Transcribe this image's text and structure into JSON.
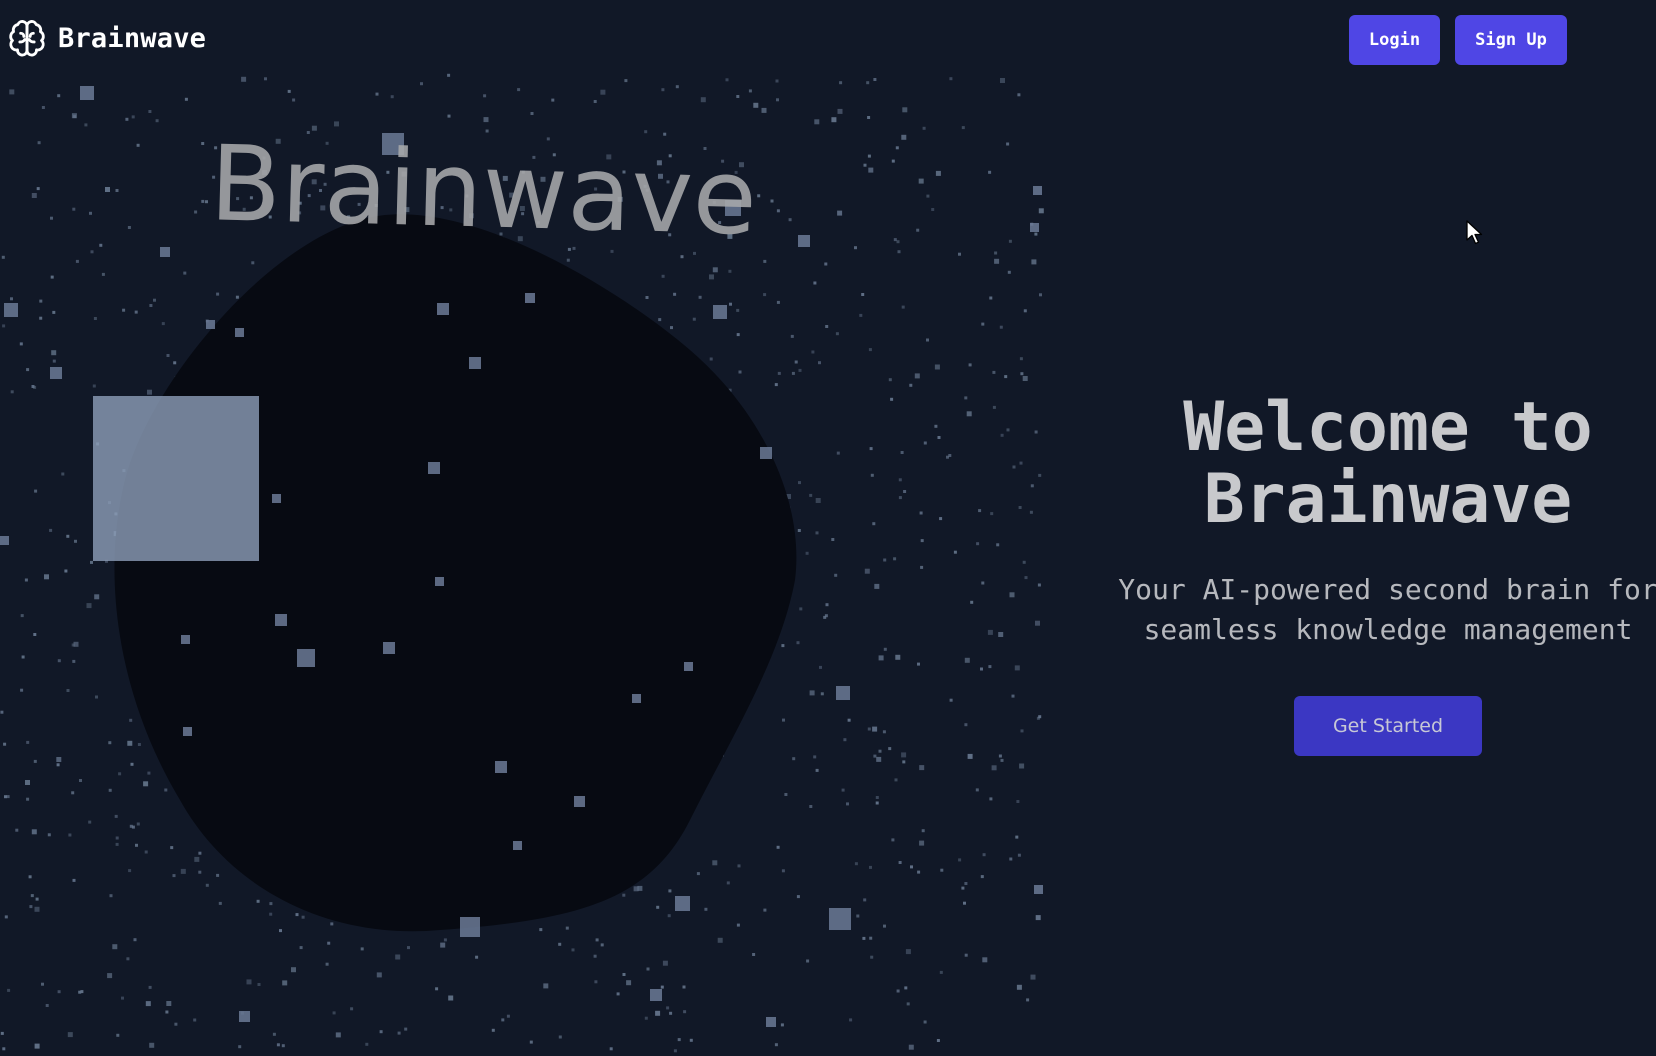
{
  "header": {
    "brand_name": "Brainwave",
    "login_label": "Login",
    "signup_label": "Sign Up"
  },
  "visual": {
    "overlay_text": "Brainwave"
  },
  "hero": {
    "title_line1": "Welcome to",
    "title_line2": "Brainwave",
    "subtitle_line1": "Your AI-powered second brain for",
    "subtitle_line2": "seamless knowledge management",
    "cta_label": "Get Started"
  },
  "icons": {
    "brand": "brain-icon",
    "cursor": "mouse-pointer-icon"
  },
  "colors": {
    "background": "#111827",
    "accent": "#4f46e5",
    "cta": "#3b37c3",
    "particle": "#64748b",
    "blob": "#070a12"
  }
}
